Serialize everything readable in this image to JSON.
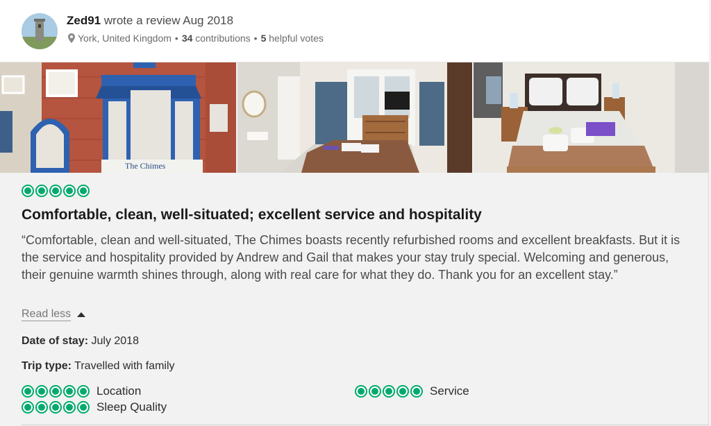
{
  "reviewer": {
    "name": "Zed91",
    "action": "wrote a review Aug 2018",
    "location": "York, United Kingdom",
    "contributions_count": "34",
    "contributions_label": "contributions",
    "helpful_count": "5",
    "helpful_label": "helpful votes",
    "separator": "•"
  },
  "photos": [
    {
      "icon": "building-exterior-photo",
      "sign_text": "The Chimes"
    },
    {
      "icon": "bedroom-photo"
    },
    {
      "icon": "double-bedroom-photo"
    }
  ],
  "review": {
    "rating": 5,
    "rating_max": 5,
    "title": "Comfortable, clean, well-situated; excellent service and hospitality",
    "body": "“Comfortable, clean and well-situated, The Chimes boasts recently refurbished rooms and excellent breakfasts. But it is the service and hospitality provided by Andrew and Gail that makes your stay truly special. Welcoming and generous, their genuine warmth shines through, along with real care for what they do. Thank you for an excellent stay.”",
    "read_less_label": "Read less",
    "date_of_stay_label": "Date of stay:",
    "date_of_stay_value": "July 2018",
    "trip_type_label": "Trip type:",
    "trip_type_value": "Travelled with family"
  },
  "subratings": [
    {
      "label": "Location",
      "rating": 5
    },
    {
      "label": "Service",
      "rating": 5
    },
    {
      "label": "Sleep Quality",
      "rating": 5
    }
  ],
  "colors": {
    "bubble_green": "#00aa6c",
    "text_dark": "#1a1a1a",
    "text_muted": "#6b6b6b"
  }
}
